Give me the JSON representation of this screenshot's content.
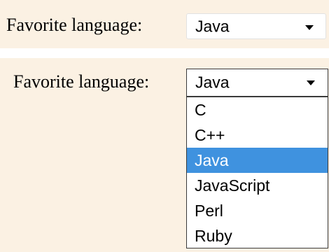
{
  "form_closed": {
    "label": "Favorite language:",
    "selected_value": "Java",
    "arrow_icon": "chevron-down-icon"
  },
  "form_open": {
    "label": "Favorite language:",
    "selected_value": "Java",
    "arrow_icon": "chevron-down-icon",
    "options": [
      "C",
      "C++",
      "Java",
      "JavaScript",
      "Perl",
      "Ruby"
    ],
    "highlighted_option": "Java"
  },
  "colors": {
    "page_background": "#fbf1e3",
    "highlight": "#3f92df",
    "highlight_text": "#ffffff",
    "select_background": "#ffffff"
  }
}
